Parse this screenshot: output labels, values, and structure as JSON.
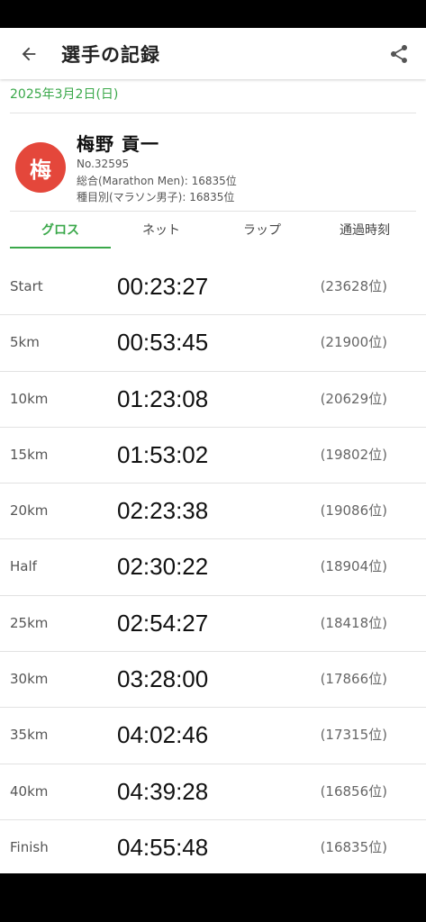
{
  "header": {
    "title": "選手の記録",
    "back_icon": "arrow-left-icon",
    "share_icon": "share-icon"
  },
  "date": "2025年3月2日(日)",
  "runner": {
    "avatar_char": "梅",
    "avatar_color": "#e4473b",
    "name": "梅野 貢一",
    "number": "No.32595",
    "overall": "総合(Marathon Men): 16835位",
    "category": "種目別(マラソン男子): 16835位"
  },
  "tabs": [
    {
      "label": "グロス",
      "active": true
    },
    {
      "label": "ネット",
      "active": false
    },
    {
      "label": "ラップ",
      "active": false
    },
    {
      "label": "通過時刻",
      "active": false
    }
  ],
  "accent_color": "#3aa84a",
  "splits": [
    {
      "label": "Start",
      "time": "00:23:27",
      "rank": "(23628位)"
    },
    {
      "label": "5km",
      "time": "00:53:45",
      "rank": "(21900位)"
    },
    {
      "label": "10km",
      "time": "01:23:08",
      "rank": "(20629位)"
    },
    {
      "label": "15km",
      "time": "01:53:02",
      "rank": "(19802位)"
    },
    {
      "label": "20km",
      "time": "02:23:38",
      "rank": "(19086位)"
    },
    {
      "label": "Half",
      "time": "02:30:22",
      "rank": "(18904位)"
    },
    {
      "label": "25km",
      "time": "02:54:27",
      "rank": "(18418位)"
    },
    {
      "label": "30km",
      "time": "03:28:00",
      "rank": "(17866位)"
    },
    {
      "label": "35km",
      "time": "04:02:46",
      "rank": "(17315位)"
    },
    {
      "label": "40km",
      "time": "04:39:28",
      "rank": "(16856位)"
    },
    {
      "label": "Finish",
      "time": "04:55:48",
      "rank": "(16835位)"
    }
  ]
}
